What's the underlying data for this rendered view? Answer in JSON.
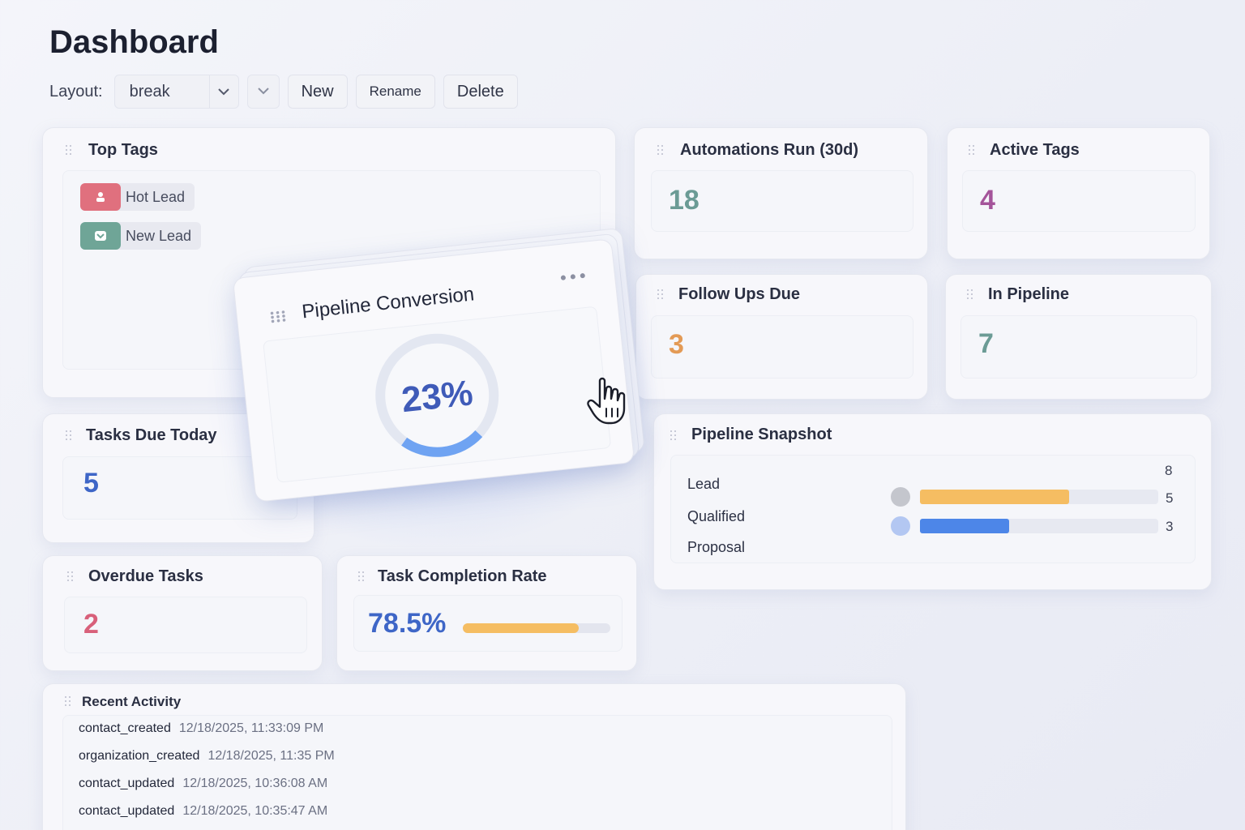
{
  "page": {
    "title": "Dashboard"
  },
  "toolbar": {
    "layout_label": "Layout:",
    "layout_value": "break",
    "new_label": "New",
    "rename_label": "Rename",
    "delete_label": "Delete"
  },
  "top_tags": {
    "title": "Top Tags",
    "tags": [
      {
        "label": "Hot Lead",
        "color": "#e0707e",
        "icon": "person-icon"
      },
      {
        "label": "New Lead",
        "color": "#6fa597",
        "icon": "inbox-icon"
      }
    ]
  },
  "automations": {
    "title": "Automations Run (30d)",
    "value": "18",
    "color": "#6b9b95"
  },
  "active_tags": {
    "title": "Active Tags",
    "value": "4",
    "color": "#a4549a"
  },
  "follow_ups": {
    "title": "Follow Ups Due",
    "value": "3",
    "color": "#e39a55"
  },
  "in_pipeline": {
    "title": "In Pipeline",
    "value": "7",
    "color": "#6b9b95"
  },
  "tasks_today": {
    "title": "Tasks Due Today",
    "value": "5",
    "color": "#3e66c7"
  },
  "overdue": {
    "title": "Overdue Tasks",
    "value": "2",
    "color": "#d8607a"
  },
  "completion": {
    "title": "Task Completion Rate",
    "value": "78.5%",
    "percent": 78.5,
    "color": "#3e66c7",
    "bar_color": "#f5bd62"
  },
  "pipeline_conversion": {
    "title": "Pipeline Conversion",
    "value": "23%",
    "percent": 23,
    "ring_color": "#6fa3f2"
  },
  "pipeline_snapshot": {
    "title": "Pipeline Snapshot",
    "stages": [
      "Lead",
      "Qualified",
      "Proposal"
    ],
    "max_label": "8",
    "bars": [
      {
        "value": 5,
        "label": "5",
        "color": "#f5bd62",
        "dot_color": "#c4c6cd"
      },
      {
        "value": 3,
        "label": "3",
        "color": "#4d86e8",
        "dot_color": "#b3c7f2"
      }
    ],
    "max": 8
  },
  "recent_activity": {
    "title": "Recent Activity",
    "items": [
      {
        "event": "contact_created",
        "time": "12/18/2025, 11:33:09 PM"
      },
      {
        "event": "organization_created",
        "time": "12/18/2025, 11:35 PM"
      },
      {
        "event": "contact_updated",
        "time": "12/18/2025, 10:36:08 AM"
      },
      {
        "event": "contact_updated",
        "time": "12/18/2025, 10:35:47 AM"
      }
    ]
  }
}
